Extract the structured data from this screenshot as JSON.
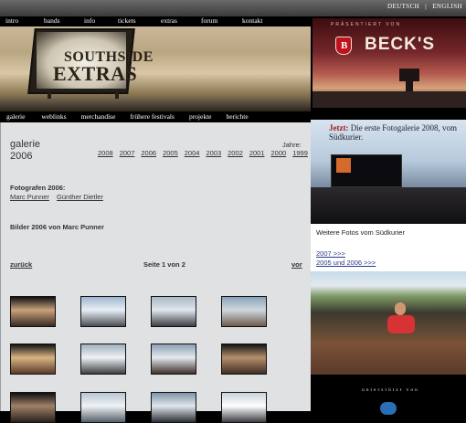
{
  "lang": {
    "de": "Deutsch",
    "sep": "|",
    "en": "English"
  },
  "main_nav": [
    "intro",
    "bands",
    "info",
    "tickets",
    "extras",
    "forum",
    "kontakt"
  ],
  "hero": {
    "sign_line1": "SOUTHSIDE",
    "sign_line2": "EXTRAS"
  },
  "sub_nav": [
    "galerie",
    "weblinks",
    "merchandise",
    "frühere festivals",
    "projekte",
    "berichte"
  ],
  "gallery": {
    "title_line1": "galerie",
    "title_line2": "2006",
    "years_label": "Jahre:",
    "years": [
      "2008",
      "2007",
      "2006",
      "2005",
      "2004",
      "2003",
      "2002",
      "2001",
      "2000",
      "1999"
    ],
    "photographers_label": "Fotografen 2006:",
    "photographers": [
      "Marc Punner",
      "Günther Dietler"
    ],
    "images_by": "Bilder 2006 von Marc Punner",
    "back": "zurück",
    "page_prefix": "Seite",
    "page_current": "1",
    "page_of": "von",
    "page_total": "2",
    "next": "vor"
  },
  "thumbnails": [
    {
      "name": "hand-crowd-photo",
      "palette": [
        "#101010",
        "#c9a27d",
        "#3a2a22"
      ]
    },
    {
      "name": "stage-sky-photo",
      "palette": [
        "#9fb6cf",
        "#e7eef5",
        "#4b4f55"
      ]
    },
    {
      "name": "stage-field-photo",
      "palette": [
        "#aab8c6",
        "#dfe6ed",
        "#3c3e44"
      ]
    },
    {
      "name": "crowd-field-photo",
      "palette": [
        "#8aa2b8",
        "#cfd8df",
        "#6d5b4d"
      ]
    },
    {
      "name": "fireworks-photo",
      "palette": [
        "#141414",
        "#d8b483",
        "#5a3b2a"
      ]
    },
    {
      "name": "crowd-rain-photo",
      "palette": [
        "#9fb0bf",
        "#eef2f5",
        "#3a3f42"
      ]
    },
    {
      "name": "stage-crowd-photo",
      "palette": [
        "#8c9fb3",
        "#e3e9ee",
        "#402f2b"
      ]
    },
    {
      "name": "bar-photo",
      "palette": [
        "#151515",
        "#b58f6c",
        "#3f2e25"
      ]
    },
    {
      "name": "dark-crowd-photo",
      "palette": [
        "#0f0f0f",
        "#9f8168",
        "#2a221d"
      ]
    },
    {
      "name": "tent-photo",
      "palette": [
        "#b7c6d2",
        "#f0f3f5",
        "#55606a"
      ]
    },
    {
      "name": "main-stage-photo",
      "palette": [
        "#7e94a8",
        "#dfe6ec",
        "#2b2f35"
      ]
    },
    {
      "name": "screen-photo",
      "palette": [
        "#c9d3db",
        "#ffffff",
        "#3b3d41"
      ]
    }
  ],
  "sponsor": {
    "presents": "PRÄSENTIERT VON",
    "brand": "BECK'S",
    "key_glyph": "B"
  },
  "promo": {
    "jetzt": "Jetzt:",
    "text": " Die erste Fotogalerie 2008, vom Südkurier."
  },
  "more": {
    "title": "Weitere Fotos vom Südkurier",
    "link1": "2007 >>>",
    "link2": "2005 und 2006 >>>"
  },
  "support": {
    "text": "unterstützt von"
  },
  "colors": {
    "content_bg": "#dfe1e2",
    "nav_bg": "#000000",
    "link": "#2a3a8a",
    "becks_red": "#c0121c"
  }
}
